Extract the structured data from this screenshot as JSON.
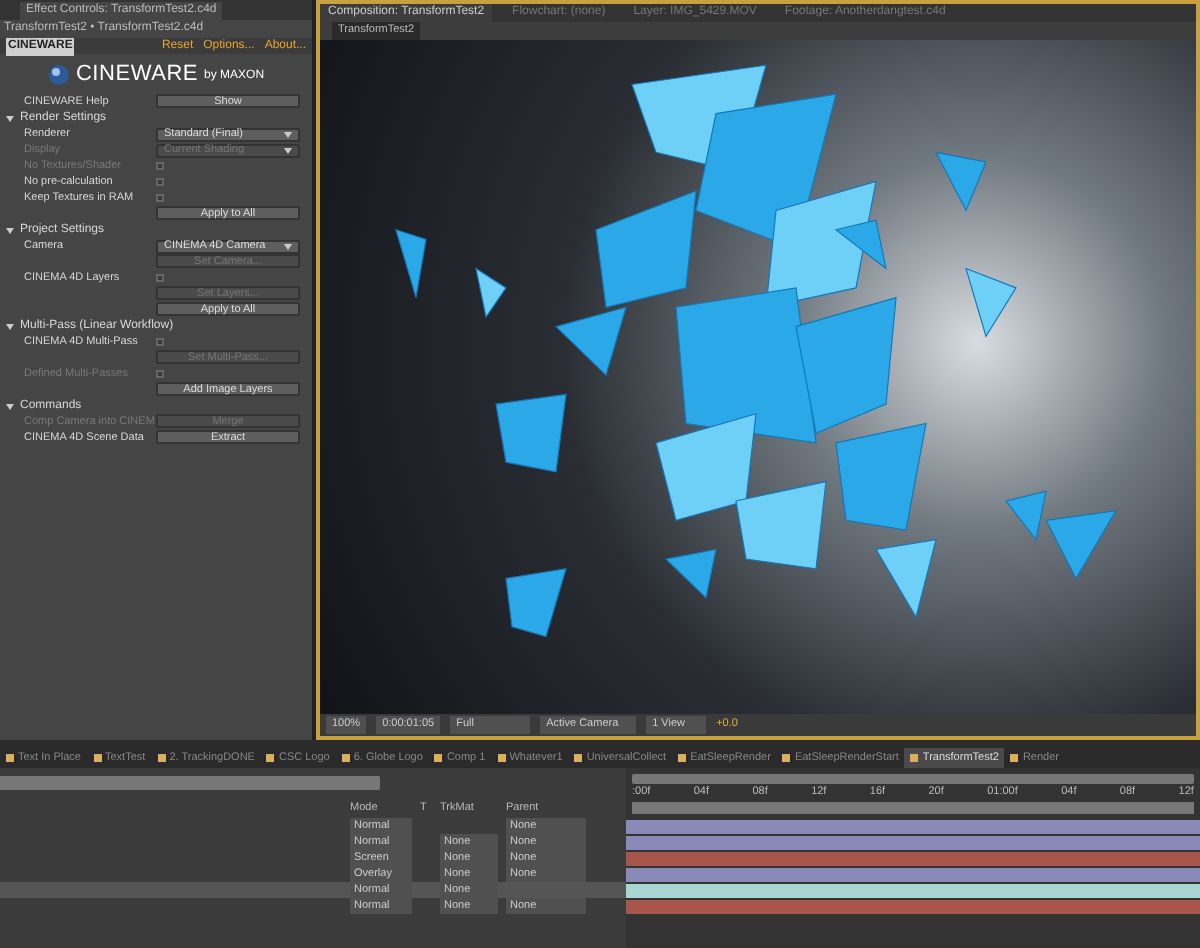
{
  "effect_panel": {
    "tab": "Effect Controls: TransformTest2.c4d",
    "breadcrumb": "TransformTest2 • TransformTest2.c4d",
    "effect_name": "CINEWARE",
    "links": [
      "Reset",
      "Options...",
      "About..."
    ],
    "logo": {
      "name": "CINEWARE",
      "by": "by MAXON"
    },
    "rows": [
      {
        "kind": "button",
        "label": "CINEWARE Help",
        "button": "Show",
        "disabled": false
      },
      {
        "kind": "section",
        "label": "Render Settings",
        "expanded": true
      },
      {
        "kind": "dropdown",
        "label": "Renderer",
        "value": "Standard (Final)",
        "disabled": false
      },
      {
        "kind": "dropdown",
        "label": "Display",
        "value": "Current Shading",
        "disabled": true
      },
      {
        "kind": "checkbox",
        "label": "No Textures/Shader",
        "checked": false,
        "disabled": true
      },
      {
        "kind": "checkbox",
        "label": "No pre-calculation",
        "checked": false,
        "disabled": false
      },
      {
        "kind": "checkbox",
        "label": "Keep Textures in RAM",
        "checked": false,
        "disabled": false
      },
      {
        "kind": "button",
        "button": "Apply to All",
        "disabled": false
      },
      {
        "kind": "section",
        "label": "Project Settings",
        "expanded": true
      },
      {
        "kind": "dropdown",
        "label": "Camera",
        "value": "CINEMA 4D Camera",
        "disabled": false
      },
      {
        "kind": "button",
        "button": "Set Camera...",
        "disabled": true
      },
      {
        "kind": "checkbox",
        "label": "CINEMA 4D Layers",
        "checked": false,
        "disabled": false
      },
      {
        "kind": "button",
        "button": "Set Layers...",
        "disabled": true
      },
      {
        "kind": "button",
        "button": "Apply to All",
        "disabled": false
      },
      {
        "kind": "section",
        "label": "Multi-Pass (Linear Workflow)",
        "expanded": true
      },
      {
        "kind": "checkbox",
        "label": "CINEMA 4D Multi-Pass",
        "checked": false,
        "disabled": false
      },
      {
        "kind": "button",
        "button": "Set Multi-Pass...",
        "disabled": true
      },
      {
        "kind": "checkbox",
        "label": "Defined Multi-Passes",
        "checked": false,
        "disabled": true
      },
      {
        "kind": "button",
        "button": "Add Image Layers",
        "disabled": false
      },
      {
        "kind": "section",
        "label": "Commands",
        "expanded": true
      },
      {
        "kind": "button",
        "label": "Comp Camera into CINEM",
        "button": "Merge",
        "disabled": true
      },
      {
        "kind": "button",
        "label": "CINEMA 4D Scene Data",
        "button": "Extract",
        "disabled": false
      }
    ]
  },
  "viewer": {
    "tabs": [
      {
        "label": "Composition: TransformTest2",
        "selected": true
      },
      {
        "label": "Flowchart: (none)",
        "selected": false
      },
      {
        "label": "Layer: IMG_5429.MOV",
        "selected": false
      },
      {
        "label": "Footage: Anotherdangtest.c4d",
        "selected": false
      }
    ],
    "subtab": "TransformTest2",
    "toolbar": {
      "zoom": "100%",
      "timecode": "0:00:01:05",
      "resolution": "Full",
      "camera": "Active Camera",
      "views": "1 View",
      "exposure": "+0.0"
    }
  },
  "timeline": {
    "tabs": [
      {
        "label": "Text In Place",
        "selected": false
      },
      {
        "label": "TextTest",
        "selected": false
      },
      {
        "label": "2. TrackingDONE",
        "selected": false
      },
      {
        "label": "CSC Logo",
        "selected": false
      },
      {
        "label": "6. Globe Logo",
        "selected": false
      },
      {
        "label": "Comp 1",
        "selected": false
      },
      {
        "label": "Whatever1",
        "selected": false
      },
      {
        "label": "UniversalCollect",
        "selected": false
      },
      {
        "label": "EatSleepRender",
        "selected": false
      },
      {
        "label": "EatSleepRenderStart",
        "selected": false
      },
      {
        "label": "TransformTest2",
        "selected": true
      },
      {
        "label": "Render",
        "selected": false
      }
    ],
    "columns": [
      "Mode",
      "T",
      "TrkMat",
      "Parent"
    ],
    "ruler": [
      ":00f",
      "04f",
      "08f",
      "12f",
      "16f",
      "20f",
      "01:00f",
      "04f",
      "08f",
      "12f"
    ],
    "layers": [
      {
        "mode": "Normal",
        "parent": "None",
        "selected": false,
        "color": "#8a8ab8"
      },
      {
        "mode": "Normal",
        "trkmat": "None",
        "parent": "None",
        "selected": false,
        "color": "#8a8ab8"
      },
      {
        "mode": "Screen",
        "trkmat": "None",
        "parent": "None",
        "selected": false,
        "color": "#a8564c"
      },
      {
        "mode": "Overlay",
        "trkmat": "None",
        "parent": "None",
        "selected": false,
        "color": "#8a8ab8"
      },
      {
        "mode": "Normal",
        "trkmat": "None",
        "selected": true,
        "color": "#a9d6d2"
      },
      {
        "mode": "Normal",
        "trkmat": "None",
        "parent": "None",
        "selected": false,
        "color": "#a8564c"
      }
    ]
  }
}
